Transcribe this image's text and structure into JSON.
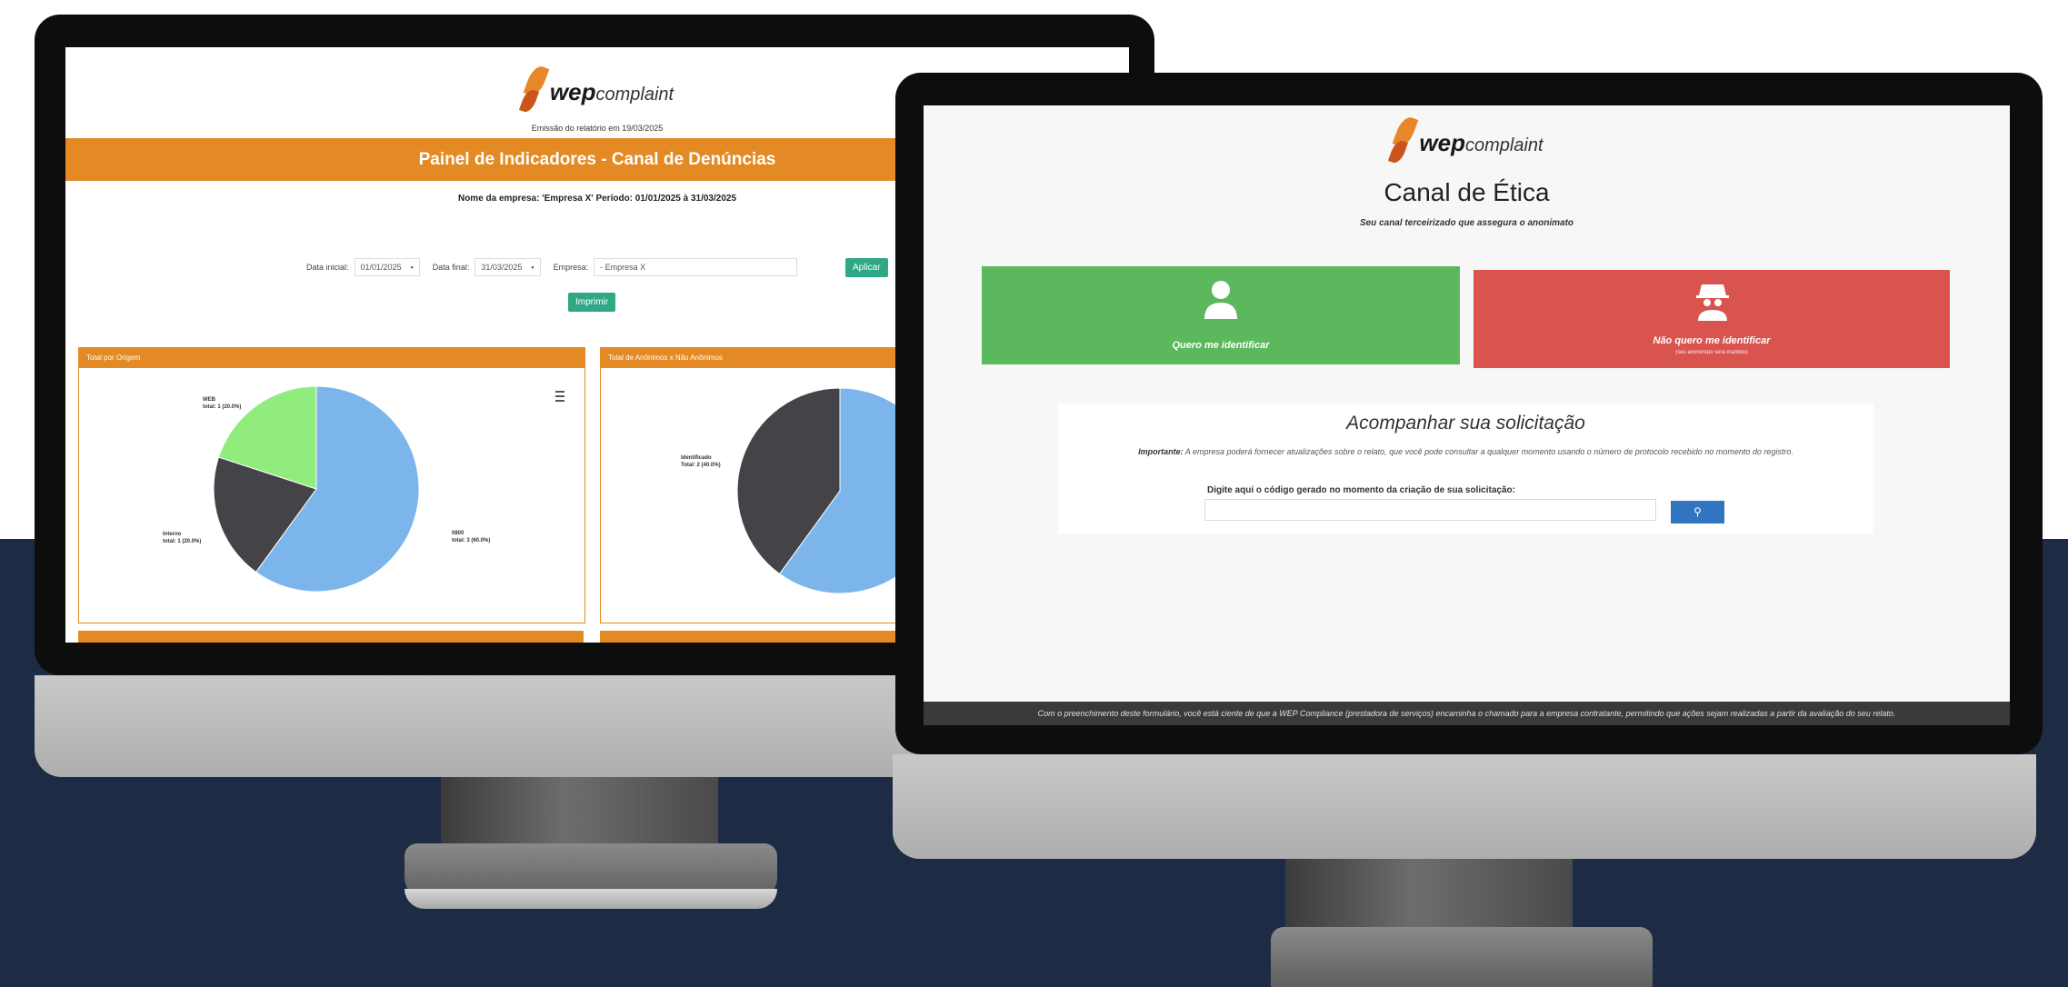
{
  "left_screen": {
    "logo": {
      "brand_bold": "wep",
      "brand_light": "complaint"
    },
    "emissao": "Emissão do relatório em 19/03/2025",
    "title": "Painel de Indicadores - Canal de Denúncias",
    "empresa_line": "Nome da empresa: 'Empresa X' Período: 01/01/2025 à 31/03/2025",
    "filters": {
      "data_inicial_label": "Data inicial:",
      "data_inicial_value": "01/01/2025",
      "data_final_label": "Data final:",
      "data_final_value": "31/03/2025",
      "empresa_label": "Empresa:",
      "empresa_value": "- Empresa X",
      "aplicar": "Aplicar",
      "imprimir": "Imprimir"
    },
    "panels": [
      {
        "title": "Total por Origem"
      },
      {
        "title": "Total de Anônimos x Não Anônimos"
      }
    ],
    "calendar_icon": "calendar-icon",
    "menu_icon": "hamburger-menu-icon"
  },
  "chart_data": [
    {
      "type": "pie",
      "title": "Total por Origem",
      "slices": [
        {
          "name": "0800",
          "value": 3,
          "percent": 60.0,
          "label": "total: 3 (60.0%)",
          "color": "#7cb5ec"
        },
        {
          "name": "Interno",
          "value": 1,
          "percent": 20.0,
          "label": "total: 1 (20.0%)",
          "color": "#434348"
        },
        {
          "name": "WEB",
          "value": 1,
          "percent": 20.0,
          "label": "total: 1 (20.0%)",
          "color": "#90ed7d"
        }
      ]
    },
    {
      "type": "pie",
      "title": "Total de Anônimos x Não Anônimos",
      "slices": [
        {
          "name": "Identificado",
          "value": 2,
          "percent": 40.0,
          "label": "Total: 2 (40.0%)",
          "color": "#434348"
        },
        {
          "name": "",
          "value": 3,
          "percent": 60.0,
          "label": "",
          "color": "#7cb5ec"
        }
      ]
    }
  ],
  "right_screen": {
    "logo": {
      "brand_bold": "wep",
      "brand_light": "complaint"
    },
    "title": "Canal de Ética",
    "subtitle": "Seu canal terceirizado que assegura o anonimato",
    "identify_button": {
      "label": "Quero me identificar",
      "icon": "user-icon",
      "color": "#5cb85c"
    },
    "anonymous_button": {
      "label": "Não quero me identificar",
      "sub": "(seu anonimato será mantido)",
      "icon": "incognito-icon",
      "color": "#d9534f"
    },
    "card": {
      "title": "Acompanhar sua solicitação",
      "note_bold": "Importante:",
      "note": " A empresa poderá fornecer atualizações sobre o relato, que você pode consultar a qualquer momento usando o número de protocolo recebido no momento do registro.",
      "input_label": "Digite aqui o código gerado no momento da criação de sua solicitação:",
      "search_icon": "search-icon"
    },
    "footer": "Com o preenchimento deste formulário, você está ciente de que a WEP Compliance (prestadora de serviços) encaminha o chamado para a empresa contratante, permitindo que ações sejam realizadas a partir da avaliação do seu relato."
  }
}
